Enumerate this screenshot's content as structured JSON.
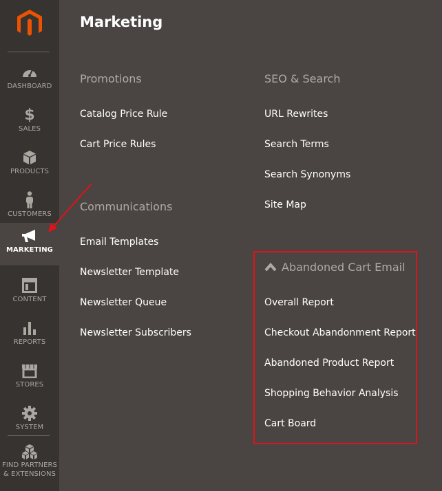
{
  "sidebar": {
    "items": [
      {
        "label": "DASHBOARD",
        "icon": "dashboard-icon"
      },
      {
        "label": "SALES",
        "icon": "dollar-icon"
      },
      {
        "label": "PRODUCTS",
        "icon": "box-icon"
      },
      {
        "label": "CUSTOMERS",
        "icon": "person-icon"
      },
      {
        "label": "MARKETING",
        "icon": "megaphone-icon",
        "active": true
      },
      {
        "label": "CONTENT",
        "icon": "layout-icon"
      },
      {
        "label": "REPORTS",
        "icon": "bar-chart-icon"
      },
      {
        "label": "STORES",
        "icon": "storefront-icon"
      },
      {
        "label": "SYSTEM",
        "icon": "gear-icon"
      }
    ],
    "extensions": {
      "line1": "FIND PARTNERS",
      "line2": "& EXTENSIONS",
      "icon": "cubes-icon"
    }
  },
  "panel": {
    "title": "Marketing",
    "promotions": {
      "title": "Promotions",
      "items": [
        "Catalog Price Rule",
        "Cart Price Rules"
      ]
    },
    "communications": {
      "title": "Communications",
      "items": [
        "Email Templates",
        "Newsletter Template",
        "Newsletter Queue",
        "Newsletter Subscribers"
      ]
    },
    "seo": {
      "title": "SEO & Search",
      "items": [
        "URL Rewrites",
        "Search Terms",
        "Search Synonyms",
        "Site Map"
      ]
    },
    "abandoned": {
      "title": "Abandoned Cart Email",
      "icon": "chevron-up-icon",
      "items": [
        "Overall Report",
        "Checkout Abandonment Report",
        "Abandoned Product Report",
        "Shopping Behavior Analysis",
        "Cart Board"
      ]
    }
  },
  "colors": {
    "sidebar": "#373330",
    "panel": "#4a4542",
    "accent": "#eb5202",
    "highlight": "#e0121b"
  }
}
